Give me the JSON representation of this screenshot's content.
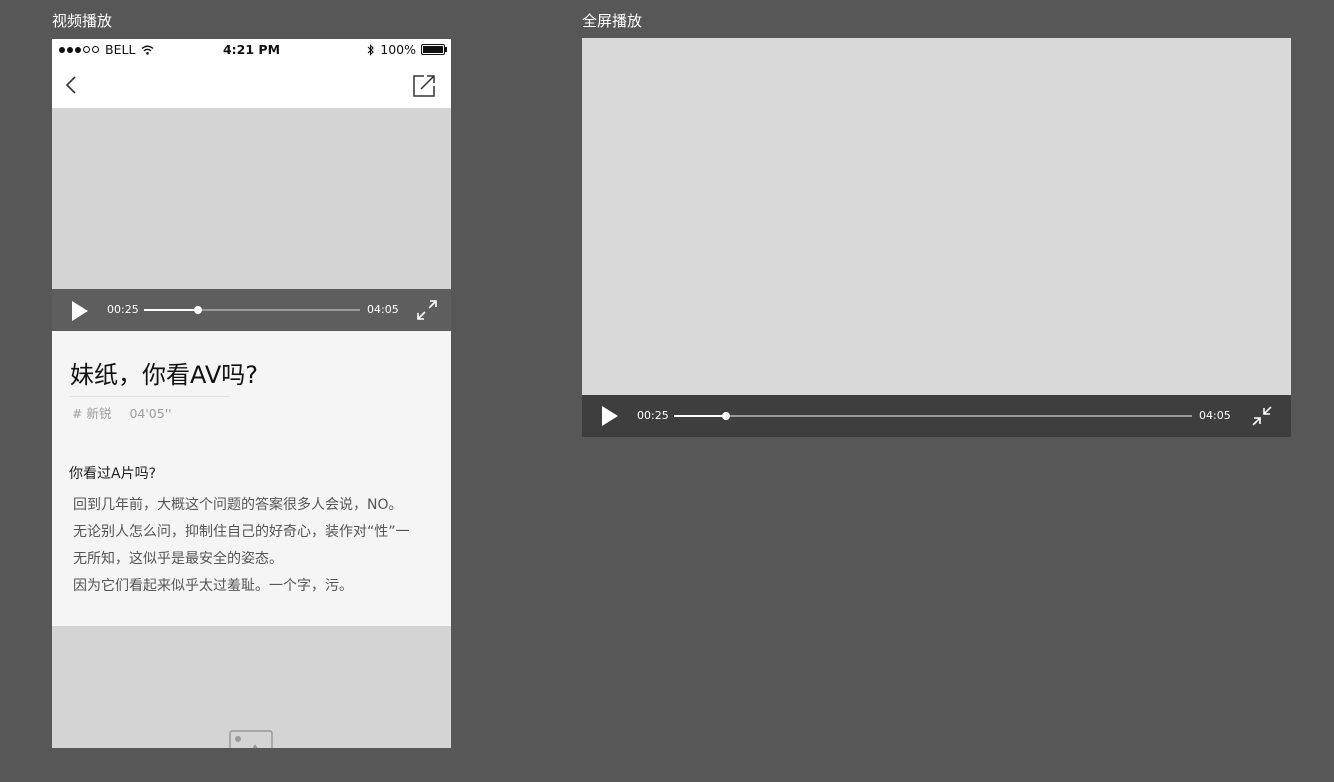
{
  "labels": {
    "left": "视频播放",
    "right": "全屏播放"
  },
  "status_bar": {
    "carrier": "BELL",
    "time": "4:21 PM",
    "battery": "100%"
  },
  "player": {
    "current_time": "00:25",
    "total_time": "04:05",
    "progress_fraction": 0.25
  },
  "article": {
    "title": "妹纸，你看AV吗?",
    "tag": "# 新锐",
    "duration": "04'05''",
    "question": "你看过A片吗?",
    "paragraph_lines": [
      "回到几年前，大概这个问题的答案很多人会说，NO。",
      "无论别人怎么问，抑制住自己的好奇心，装作对“性”一",
      "无所知，这似乎是最安全的姿态。",
      "因为它们看起来似乎太过羞耻。一个字，污。"
    ]
  },
  "fullscreen_player": {
    "current_time": "00:25",
    "total_time": "04:05",
    "progress_fraction": 0.1
  },
  "icons": [
    "back-icon",
    "share-icon",
    "play-icon",
    "fullscreen-icon",
    "exit-fullscreen-icon",
    "wifi-icon",
    "bluetooth-icon",
    "battery-icon",
    "image-placeholder-icon"
  ]
}
